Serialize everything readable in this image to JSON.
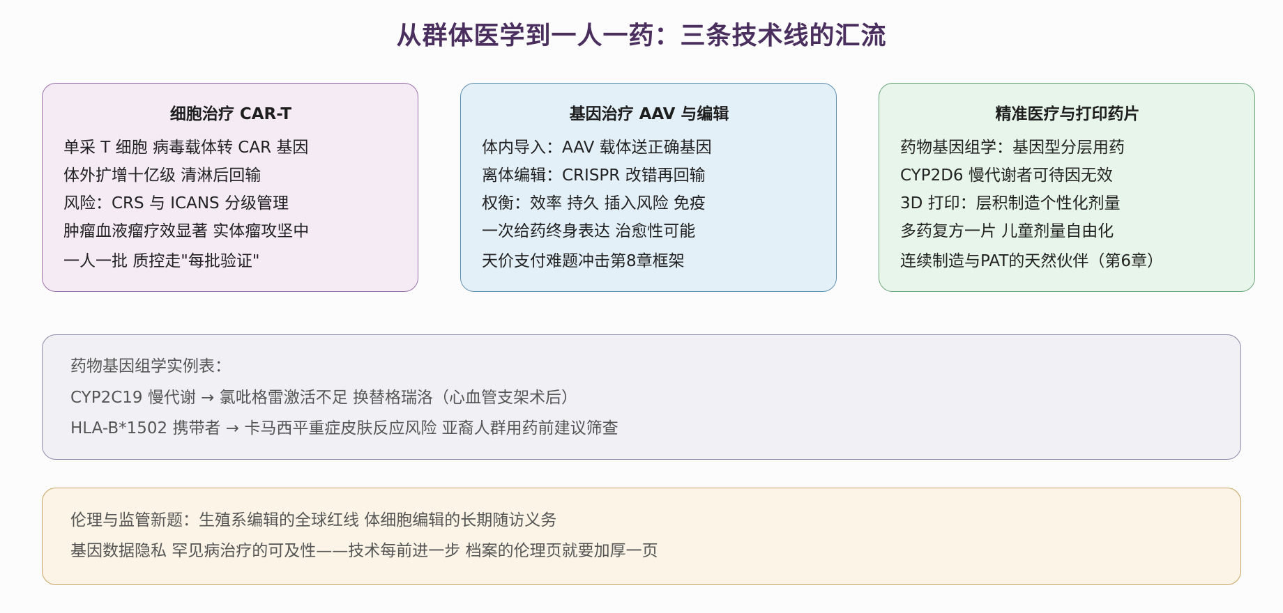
{
  "title": "从群体医学到一人一药：三条技术线的汇流",
  "cards": [
    {
      "heading": "细胞治疗 CAR-T",
      "lines": [
        "单采 T 细胞 病毒载体转 CAR 基因",
        "体外扩增十亿级 清淋后回输",
        "风险：CRS 与 ICANS 分级管理",
        "肿瘤血液瘤疗效显著 实体瘤攻坚中",
        "一人一批 质控走\"每批验证\""
      ]
    },
    {
      "heading": "基因治疗 AAV 与编辑",
      "lines": [
        "体内导入：AAV 载体送正确基因",
        "离体编辑：CRISPR 改错再回输",
        "权衡：效率 持久 插入风险 免疫",
        "一次给药终身表达 治愈性可能",
        "天价支付难题冲击第8章框架"
      ]
    },
    {
      "heading": "精准医疗与打印药片",
      "lines": [
        "药物基因组学：基因型分层用药",
        "CYP2D6 慢代谢者可待因无效",
        "3D 打印：层积制造个性化剂量",
        "多药复方一片 儿童剂量自由化",
        "连续制造与PAT的天然伙伴（第6章）"
      ]
    }
  ],
  "pgx": {
    "lines": [
      "药物基因组学实例表：",
      "CYP2C19 慢代谢 → 氯吡格雷激活不足 换替格瑞洛（心血管支架术后）",
      "HLA-B*1502 携带者 → 卡马西平重症皮肤反应风险 亚裔人群用药前建议筛查"
    ]
  },
  "ethics": {
    "lines": [
      "伦理与监管新题：生殖系编辑的全球红线 体细胞编辑的长期随访义务",
      "基因数据隐私 罕见病治疗的可及性——技术每前进一步 档案的伦理页就要加厚一页"
    ]
  },
  "colors": {
    "title": "#4a2f5e",
    "card_cart_bg": "#f5ebf5",
    "card_gene_bg": "#e4f0f8",
    "card_prec_bg": "#e8f5ea",
    "pgx_bg": "#f1f1f5",
    "ethics_bg": "#fcf4e6"
  }
}
